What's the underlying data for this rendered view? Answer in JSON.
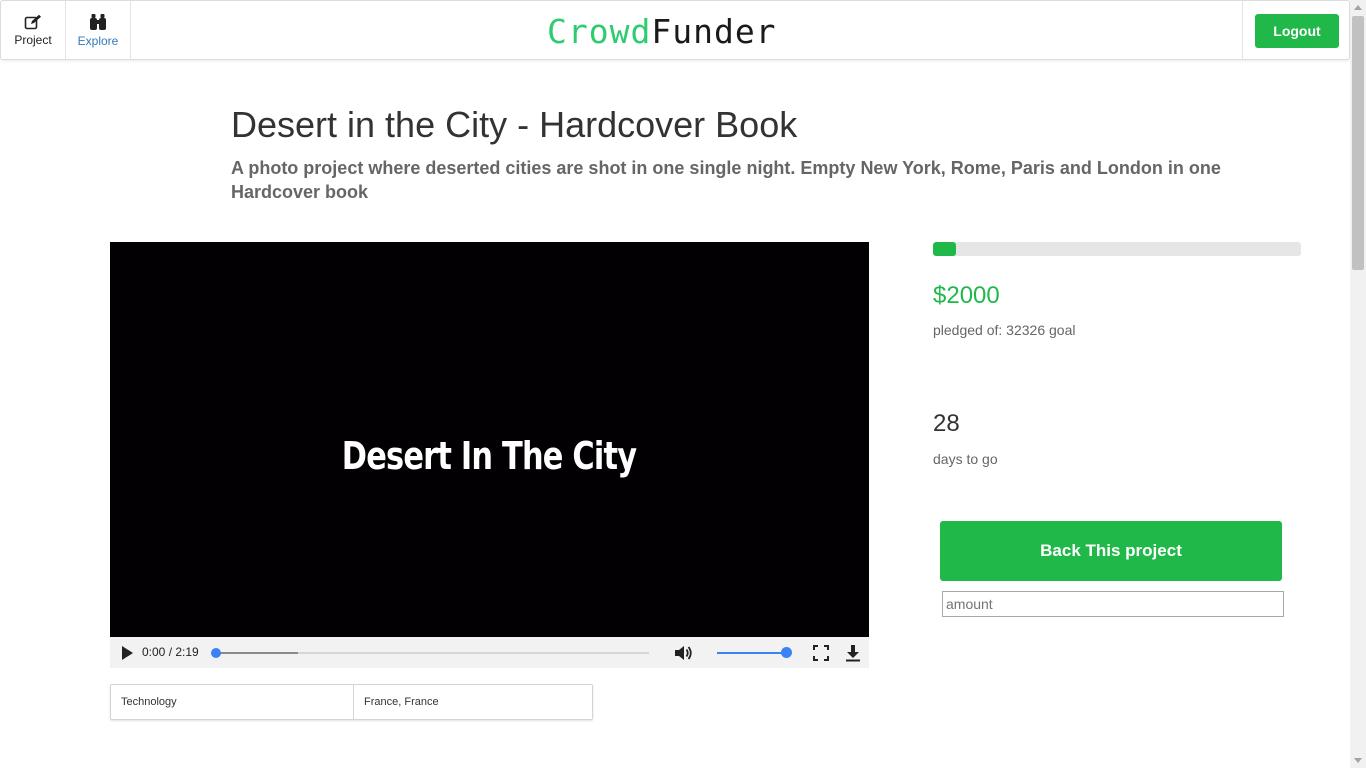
{
  "navbar": {
    "project_label": "Project",
    "explore_label": "Explore",
    "brand_part1": "Crowd",
    "brand_part2": "Funder",
    "logout_label": "Logout"
  },
  "project": {
    "title": "Desert in the City - Hardcover Book",
    "subtitle": "A photo project where deserted cities are shot in one single night. Empty New York, Rome, Paris and London in one Hardcover book",
    "category": "Technology",
    "location": "France, France"
  },
  "video": {
    "caption": "Desert In The City",
    "time": "0:00 / 2:19",
    "played_fraction": 0.0,
    "buffered_fraction": 0.19,
    "volume_fraction": 1.0
  },
  "funding": {
    "progress_fraction": 0.062,
    "pledged": "$2000",
    "pledged_label": "pledged of: 32326 goal",
    "days": "28",
    "days_label": "days to go",
    "back_label": "Back This project",
    "amount_placeholder": "amount"
  },
  "colors": {
    "accent": "#21b84a",
    "link": "#337ab7",
    "brand_green": "#2ecc71"
  },
  "icons": [
    "edit-icon",
    "binoculars-icon",
    "play-icon",
    "volume-icon",
    "fullscreen-icon",
    "download-icon"
  ]
}
